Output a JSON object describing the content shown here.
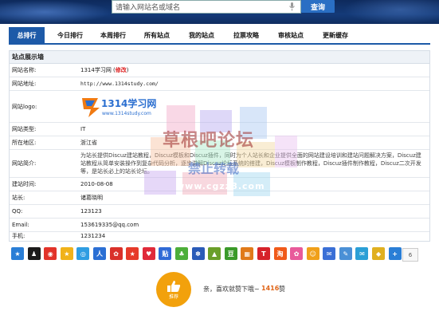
{
  "search": {
    "placeholder": "请输入网站名或域名",
    "button": "查询"
  },
  "nav": {
    "tabs": [
      {
        "label": "总排行",
        "active": true
      },
      {
        "label": "今日排行"
      },
      {
        "label": "本周排行"
      },
      {
        "label": "所有站点"
      },
      {
        "label": "我的站点"
      },
      {
        "label": "拉票攻略"
      },
      {
        "label": "审核站点"
      },
      {
        "label": "更新缓存"
      }
    ]
  },
  "panel": {
    "title": "站点展示墙",
    "rows": [
      {
        "key": "网站名称:",
        "value": "1314学习网",
        "edit": "修改"
      },
      {
        "key": "网站地址:",
        "value": "http://www.1314study.com/"
      },
      {
        "key": "网站logo:",
        "logo_text": "1314学习网",
        "logo_sub": "www.1314study.com"
      },
      {
        "key": "网站类型:",
        "value": "IT"
      },
      {
        "key": "所在地区:",
        "value": "浙江省"
      },
      {
        "key": "网站简介:",
        "value": "为站长提供Discuz建站教程，Discuz模板和Discuz插件，同时为个人站长和企业提供全面的网站建设培训和建站问题解决方案，Discuz建站教程从简单安装操作到复杂代码分析，逐步讲解Discuz论坛系统的搭建，Discuz模板制作教程，Discuz插件制作教程，Discuz二次开发等，是站长必上的站长论坛。"
      },
      {
        "key": "建站时间:",
        "value": "2010-08-08"
      },
      {
        "key": "站长:",
        "value": "诸葛晓明"
      },
      {
        "key": "QQ:",
        "value": "123123"
      },
      {
        "key": "Email:",
        "value": "153619335@qq.com"
      },
      {
        "key": "手机:",
        "value": "1231234"
      }
    ]
  },
  "share": {
    "icons": [
      "qzone-icon",
      "qq-icon",
      "weibo-icon",
      "favorite-icon",
      "tencent-weibo-icon",
      "renren-icon",
      "baidu-icon",
      "star-icon",
      "heart-icon",
      "tieba-icon",
      "clover-icon",
      "paw-icon",
      "map-icon",
      "douban-icon",
      "translate-icon",
      "t-icon",
      "taobao-icon",
      "flower-icon",
      "face-icon",
      "mail-icon",
      "note-icon",
      "email-icon",
      "msg-icon",
      "plus-icon"
    ],
    "glyphs": [
      "★",
      "♟",
      "◉",
      "★",
      "◎",
      "人",
      "✿",
      "★",
      "♥",
      "贴",
      "♣",
      "✽",
      "▲",
      "豆",
      "▦",
      "T",
      "淘",
      "✿",
      "☺",
      "✉",
      "✎",
      "✉",
      "◆",
      "+"
    ],
    "colors": [
      "#2a7ed6",
      "#1b1b1b",
      "#e2332a",
      "#f0b21a",
      "#2e9de2",
      "#2b6fd4",
      "#d9302a",
      "#e63a2a",
      "#e02a3a",
      "#2f6ad6",
      "#4cae3a",
      "#2a5bb8",
      "#6a9f2a",
      "#3a9a2a",
      "#e07a1a",
      "#d6222a",
      "#f05a1a",
      "#e85a9a",
      "#f0a01a",
      "#3a6fd6",
      "#4a90d6",
      "#2a9fd6",
      "#e0b020",
      "#2a7ed6"
    ],
    "count": "6"
  },
  "like": {
    "button": "推荐",
    "text": "亲，喜欢就赞下哦~",
    "count": "1416",
    "unit": "赞"
  },
  "watermark": {
    "line1": "草根吧论坛",
    "line2": "禁止转载",
    "line3": "www.cgzz8.com"
  }
}
